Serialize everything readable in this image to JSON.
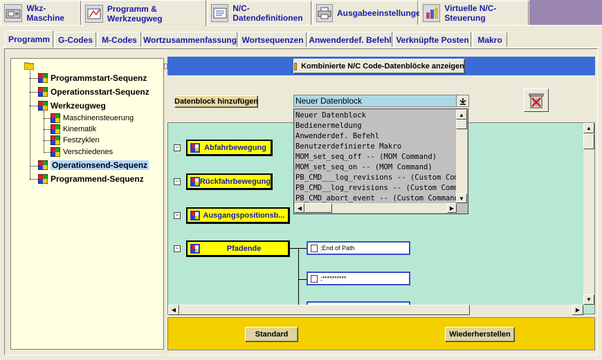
{
  "top_tabs": [
    {
      "label": "Wkz-Maschine",
      "icon": "machine-icon"
    },
    {
      "label": "Programm & Werkzeugweg",
      "icon": "program-icon",
      "active": true
    },
    {
      "label": "N/C-Datendefinitionen",
      "icon": "nc-data-icon"
    },
    {
      "label": "Ausgabeeinstellungen",
      "icon": "printer-icon"
    },
    {
      "label": "Virtuelle N/C-Steuerung",
      "icon": "virtual-nc-icon"
    }
  ],
  "sub_tabs": [
    {
      "label": "Programm",
      "active": true
    },
    {
      "label": "G-Codes"
    },
    {
      "label": "M-Codes"
    },
    {
      "label": "Wortzusammenfassung"
    },
    {
      "label": "Wortsequenzen"
    },
    {
      "label": "Anwenderdef. Befehl"
    },
    {
      "label": "Verknüpfte Posten"
    },
    {
      "label": "Makro"
    }
  ],
  "tree": {
    "items": [
      {
        "label": "Programmstart-Sequenz"
      },
      {
        "label": "Operationsstart-Sequenz"
      },
      {
        "label": "Werkzeugweg"
      },
      {
        "label": "Maschinensteuerung"
      },
      {
        "label": "Kinematik"
      },
      {
        "label": "Festzyklen"
      },
      {
        "label": "Verschiedenes"
      },
      {
        "label": "Operationsend-Sequenz",
        "selected": true
      },
      {
        "label": "Programmend-Sequenz"
      }
    ]
  },
  "toolbar": {
    "combined_label": "Kombinierte N/C Code-Datenblöcke anzeigen",
    "add_block_label": "Datenblock hinzufügen",
    "dropdown_value": "Neuer Datenblock"
  },
  "dropdown_options": [
    "Neuer Datenblock",
    "Bedienermeldung",
    "Anwenderdef. Befehl",
    "Benutzerdefinierte Makro",
    "MOM_set_seq_off -- (MOM Command)",
    "MOM_set_seq_on -- (MOM Command)",
    "PB_CMD___log_revisions -- (Custom Command)",
    "PB_CMD__log_revisions -- (Custom Command)",
    "PB_CMD_abort_event -- (Custom Command)"
  ],
  "canvas": {
    "blocks": [
      {
        "label": "Abfahrbewegung"
      },
      {
        "label": "Rückfahrbewegung"
      },
      {
        "label": "Ausgangspositionsb..."
      },
      {
        "label": "Pfadende"
      }
    ],
    "sub_items": [
      {
        "label": ";End of Path"
      },
      {
        "label": ";**********"
      },
      {
        "label": ""
      }
    ]
  },
  "bottom": {
    "standard_label": "Standard",
    "restore_label": "Wiederherstellen"
  }
}
